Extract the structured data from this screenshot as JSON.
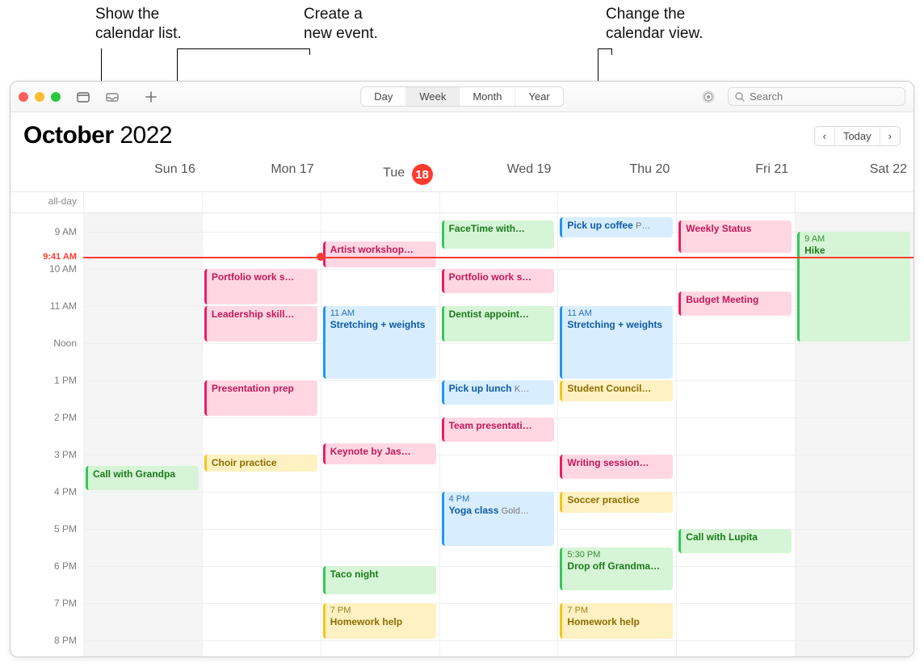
{
  "callouts": {
    "list": "Show the\ncalendar list.",
    "new": "Create a\nnew event.",
    "view": "Change the\ncalendar view."
  },
  "toolbar": {
    "views": [
      "Day",
      "Week",
      "Month",
      "Year"
    ],
    "active_view": "Week",
    "search_placeholder": "Search"
  },
  "header": {
    "month": "October",
    "year": "2022",
    "today": "Today"
  },
  "days": [
    {
      "label": "Sun",
      "num": "16",
      "today": false
    },
    {
      "label": "Mon",
      "num": "17",
      "today": false
    },
    {
      "label": "Tue",
      "num": "18",
      "today": true
    },
    {
      "label": "Wed",
      "num": "19",
      "today": false
    },
    {
      "label": "Thu",
      "num": "20",
      "today": false
    },
    {
      "label": "Fri",
      "num": "21",
      "today": false
    },
    {
      "label": "Sat",
      "num": "22",
      "today": false
    }
  ],
  "allday_label": "all-day",
  "hours": [
    "9 AM",
    "10 AM",
    "11 AM",
    "Noon",
    "1 PM",
    "2 PM",
    "3 PM",
    "4 PM",
    "5 PM",
    "6 PM",
    "7 PM",
    "8 PM"
  ],
  "now": {
    "label": "9:41 AM",
    "hour_decimal": 9.683
  },
  "events": {
    "sun": [
      {
        "title": "Call with Grandpa",
        "color": "green",
        "start": 15.3,
        "end": 16,
        "time": ""
      }
    ],
    "mon": [
      {
        "title": "Portfolio work s…",
        "color": "pink",
        "start": 10,
        "end": 11,
        "time": ""
      },
      {
        "title": "Leadership skill…",
        "color": "pink",
        "start": 11,
        "end": 12,
        "time": ""
      },
      {
        "title": "Presentation prep",
        "color": "pink",
        "start": 13,
        "end": 14,
        "time": ""
      },
      {
        "title": "Choir practice",
        "color": "yellow",
        "start": 15,
        "end": 15.5,
        "time": ""
      }
    ],
    "tue": [
      {
        "title": "Artist workshop…",
        "color": "pink",
        "start": 9.25,
        "end": 10,
        "time": ""
      },
      {
        "title": "Stretching + weights",
        "color": "blue",
        "start": 11,
        "end": 13,
        "time": "11 AM"
      },
      {
        "title": "Keynote by Jas…",
        "color": "pink",
        "start": 14.7,
        "end": 15.3,
        "time": ""
      },
      {
        "title": "Taco night",
        "color": "green",
        "start": 18,
        "end": 18.8,
        "time": ""
      },
      {
        "title": "Homework help",
        "color": "yellow",
        "start": 19,
        "end": 20,
        "time": "7 PM"
      }
    ],
    "wed": [
      {
        "title": "FaceTime with…",
        "color": "green",
        "start": 8.7,
        "end": 9.5,
        "time": ""
      },
      {
        "title": "Portfolio work s…",
        "color": "pink",
        "start": 10,
        "end": 10.7,
        "time": ""
      },
      {
        "title": "Dentist appoint…",
        "color": "green",
        "start": 11,
        "end": 12,
        "time": ""
      },
      {
        "title": "Pick up lunch",
        "color": "blue",
        "start": 13,
        "end": 13.7,
        "time": "",
        "loc": "K…"
      },
      {
        "title": "Team presentati…",
        "color": "pink",
        "start": 14,
        "end": 14.7,
        "time": ""
      },
      {
        "title": "Yoga class",
        "color": "blue",
        "start": 16,
        "end": 17.5,
        "time": "4 PM",
        "loc": "Gold…"
      }
    ],
    "thu": [
      {
        "title": "Pick up coffee",
        "color": "blue",
        "start": 8.6,
        "end": 9.2,
        "time": "",
        "loc": "P…"
      },
      {
        "title": "Stretching + weights",
        "color": "blue",
        "start": 11,
        "end": 13,
        "time": "11 AM"
      },
      {
        "title": "Student Council…",
        "color": "yellow",
        "start": 13,
        "end": 13.6,
        "time": ""
      },
      {
        "title": "Writing session…",
        "color": "pink",
        "start": 15,
        "end": 15.7,
        "time": ""
      },
      {
        "title": "Soccer practice",
        "color": "yellow",
        "start": 16,
        "end": 16.6,
        "time": ""
      },
      {
        "title": "Drop off Grandma…",
        "color": "green",
        "start": 17.5,
        "end": 18.7,
        "time": "5:30 PM"
      },
      {
        "title": "Homework help",
        "color": "yellow",
        "start": 19,
        "end": 20,
        "time": "7 PM"
      }
    ],
    "fri": [
      {
        "title": "Weekly Status",
        "color": "pink",
        "start": 8.7,
        "end": 9.6,
        "time": ""
      },
      {
        "title": "Budget Meeting",
        "color": "pink",
        "start": 10.6,
        "end": 11.3,
        "time": ""
      },
      {
        "title": "Call with Lupita",
        "color": "green",
        "start": 17,
        "end": 17.7,
        "time": ""
      }
    ],
    "sat": [
      {
        "title": "Hike",
        "color": "green",
        "start": 9,
        "end": 12,
        "time": "9 AM"
      }
    ]
  }
}
